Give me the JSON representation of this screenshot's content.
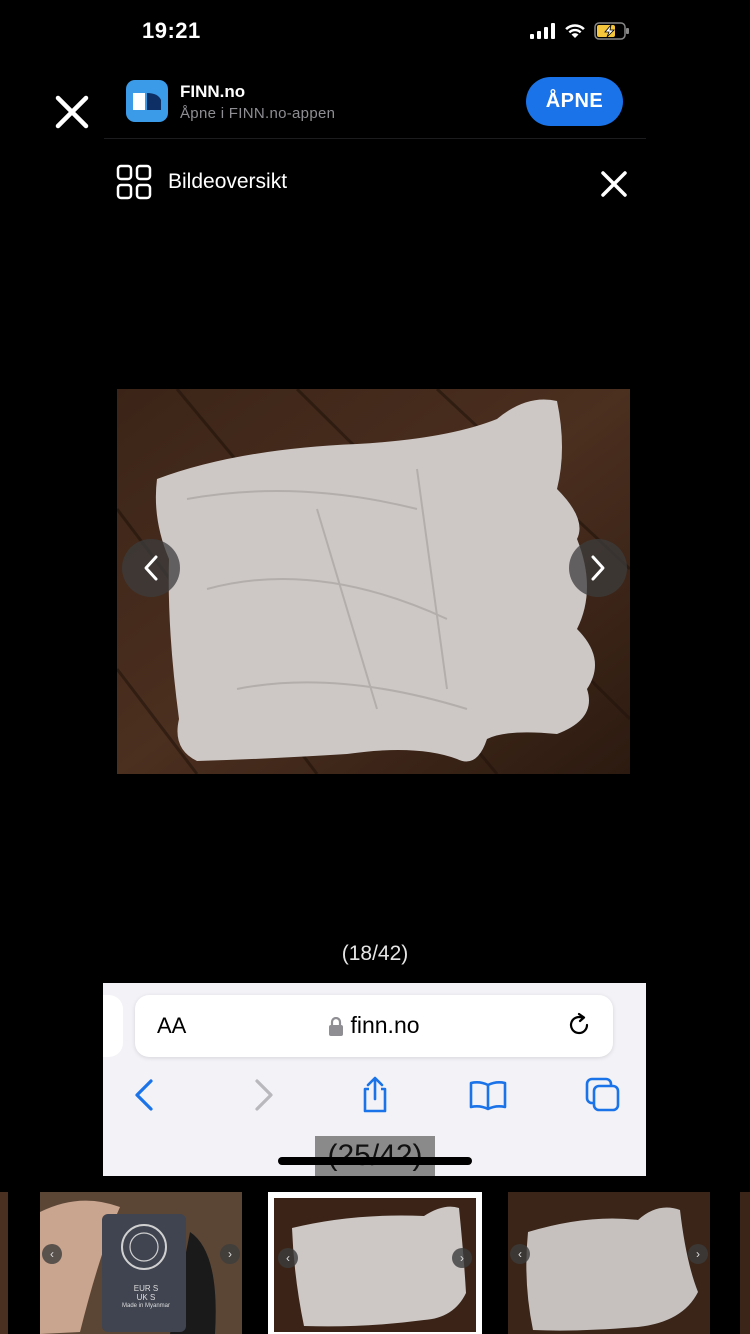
{
  "status_bar": {
    "time": "19:21",
    "icons": [
      "signal-icon",
      "wifi-icon",
      "battery-charging-icon"
    ]
  },
  "smart_banner": {
    "app_name": "FINN.no",
    "subtitle": "Åpne i FINN.no-appen",
    "open_label": "ÅPNE",
    "accent": "#1a73e8"
  },
  "gallery": {
    "header_title": "Bildeoversikt",
    "counter": "(18/42)",
    "thumb_counter": "(25/42)"
  },
  "safari": {
    "text_size_label": "AA",
    "url": "finn.no"
  },
  "thumbnails": [
    {
      "name": "thumb-partial-left"
    },
    {
      "name": "thumb-label",
      "label_lines": [
        "EUR S",
        "UK S",
        "Made in Myanmar"
      ]
    },
    {
      "name": "thumb-selected"
    },
    {
      "name": "thumb-next"
    },
    {
      "name": "thumb-partial-right"
    }
  ]
}
